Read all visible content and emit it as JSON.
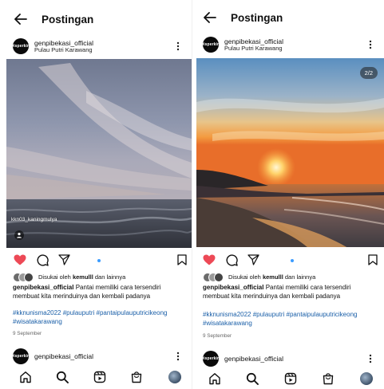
{
  "colors": {
    "like_red": "#ed4956",
    "tag_blue": "#1a5fa8",
    "indicator_blue": "#3b9cff"
  },
  "left": {
    "header": {
      "title": "Postingan"
    },
    "post": {
      "avatar_text": "Disperkim",
      "username": "genpibekasi_official",
      "location": "Pulau Putri Karawang",
      "photo_tag": "kkn03_kaningmulya",
      "liked": true,
      "liked_by": "kemulll",
      "likes_prefix": "Disukai oleh",
      "likes_suffix": "dan lainnya",
      "caption_user": "genpibekasi_official",
      "caption_text": "Pantai memiliki cara tersendiri membuat kita merinduinya dan kembali padanya",
      "hashtags": "#kknunisma2022 #pulauputri #pantaipulauputricikeong #wisatakarawang",
      "date": "9 September"
    },
    "next_post": {
      "username": "genpibekasi_official"
    }
  },
  "right": {
    "header": {
      "title": "Postingan"
    },
    "post": {
      "avatar_text": "Disperkim",
      "username": "genpibekasi_official",
      "location": "Pulau Putri Karawang",
      "counter": "2/2",
      "liked": true,
      "liked_by": "kemulll",
      "likes_prefix": "Disukai oleh",
      "likes_suffix": "dan lainnya",
      "caption_user": "genpibekasi_official",
      "caption_text": "Pantai memiliki cara tersendiri membuat kita merinduinya dan kembali padanya",
      "hashtags": "#kknunisma2022 #pulauputri #pantaipulauputricikeong #wisatakarawang",
      "date": "9 September"
    },
    "next_post": {
      "username": "genpibekasi_official"
    }
  },
  "nav_icons": [
    "home-icon",
    "search-icon",
    "reels-icon",
    "shop-icon",
    "profile-avatar"
  ]
}
